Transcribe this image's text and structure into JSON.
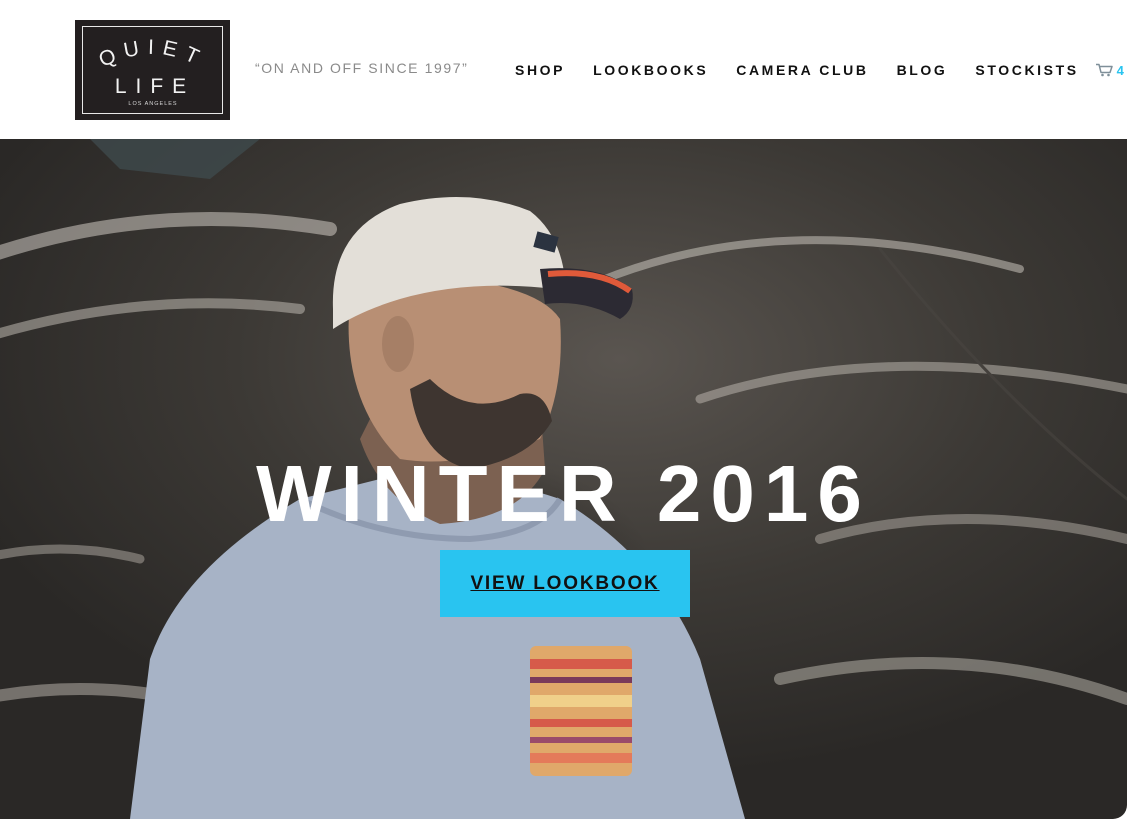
{
  "header": {
    "logo": {
      "top_text": "QUIET",
      "middle_text": "LIFE",
      "bottom_text": "LOS ANGELES"
    },
    "tagline": "“ON AND OFF SINCE 1997”",
    "nav": [
      {
        "label": "SHOP"
      },
      {
        "label": "LOOKBOOKS"
      },
      {
        "label": "CAMERA CLUB"
      },
      {
        "label": "BLOG"
      },
      {
        "label": "STOCKISTS"
      }
    ],
    "cart": {
      "icon": "cart-icon",
      "count": "4"
    }
  },
  "hero": {
    "title": "WINTER 2016",
    "cta_label": "VIEW LOOKBOOK"
  },
  "colors": {
    "accent": "#29c4f0",
    "logo_bg": "#231f20",
    "nav_text": "#111111",
    "tagline": "#8a8a8a"
  }
}
